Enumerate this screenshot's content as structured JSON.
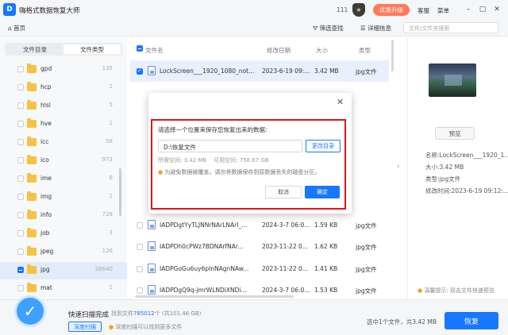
{
  "window": {
    "title": "嗨格式数据恢复大师",
    "logo_letter": "D",
    "count": "111",
    "upgrade_label": "优惠升级",
    "service_label": "客服",
    "menu_label": "菜单",
    "minimize": "–",
    "restore": "▢",
    "close": "✕"
  },
  "toolbar": {
    "home_label": "首页",
    "filter_label": "筛选查找",
    "details_label": "详细信息",
    "search_placeholder": "文件/文件夹搜索"
  },
  "sidebar": {
    "tabs": [
      "文件目录",
      "文件类型"
    ],
    "active_tab": "文件类型",
    "folders": [
      {
        "name": "gpd",
        "count": "135"
      },
      {
        "name": "hcp",
        "count": "1"
      },
      {
        "name": "hlsl",
        "count": "5"
      },
      {
        "name": "hve",
        "count": "1"
      },
      {
        "name": "icc",
        "count": "58"
      },
      {
        "name": "ico",
        "count": "973"
      },
      {
        "name": "ime",
        "count": "6"
      },
      {
        "name": "img",
        "count": "1"
      },
      {
        "name": "info",
        "count": "728"
      },
      {
        "name": "job",
        "count": "3"
      },
      {
        "name": "jpeg",
        "count": "126"
      },
      {
        "name": "jpg",
        "count": "26640",
        "selected": true
      },
      {
        "name": "mat",
        "count": "1"
      }
    ]
  },
  "file_list": {
    "columns": [
      "文件名",
      "修改日期",
      "大小",
      "类型"
    ],
    "rows": [
      {
        "name": "LockScreen___1920_1080_not...",
        "date": "2023-6-19 09:...",
        "size": "3.42 MB",
        "type": "jpg文件",
        "selected": true
      },
      {
        "name": "IADPDgtYyTLJNNrNArLNArI_...",
        "date": "2024-3-7 06:0...",
        "size": "1.59 KB",
        "type": "jpg文件"
      },
      {
        "name": "IADPDh0cPWz7BDNArfNAr...",
        "date": "2023-11-22 0...",
        "size": "1.62 KB",
        "type": "jpg文件"
      },
      {
        "name": "IADPGoGu6uy6pInNAgnNAw...",
        "date": "2023-11-22 0...",
        "size": "1.41 KB",
        "type": "jpg文件"
      },
      {
        "name": "IADPDgQ9q-jmrWLNDiXNDi...",
        "date": "2024-3-7 06:0...",
        "size": "1.53 KB",
        "type": "jpg文件"
      }
    ]
  },
  "preview": {
    "preview_button": "预览",
    "name": "名称:LockScreen___1920_1...",
    "size": "大小:3.42 MB",
    "type": "类型:jpg文件",
    "modified": "修改时间:2023-6-19 09:12:...",
    "tip": "温馨提示: 双击文件快速预览"
  },
  "bottom": {
    "scan_title": "快速扫描完成",
    "found_prefix": "找到文件",
    "found_count": "785012",
    "found_suffix": "个 (共101.46 GB)",
    "deep_scan_label": "深度扫描",
    "deep_scan_hint": "深度扫描可以找到更多文件",
    "selected_info": "选中1个文件，共3.42 MB",
    "recover_label": "恢复"
  },
  "dialog": {
    "prompt": "请选择一个位置来保存您恢复出来的数据:",
    "path_value": "D:\\恢复文件",
    "change_dir_label": "更改目录",
    "needed_space": "所需空间:  3.42 MB",
    "free_space": "可用空间:  758.67 GB",
    "warning": "为避免数据被覆盖，请勿将数据保存到原数据丢失的磁盘分区。",
    "cancel_label": "取消",
    "ok_label": "确定",
    "close": "✕"
  }
}
